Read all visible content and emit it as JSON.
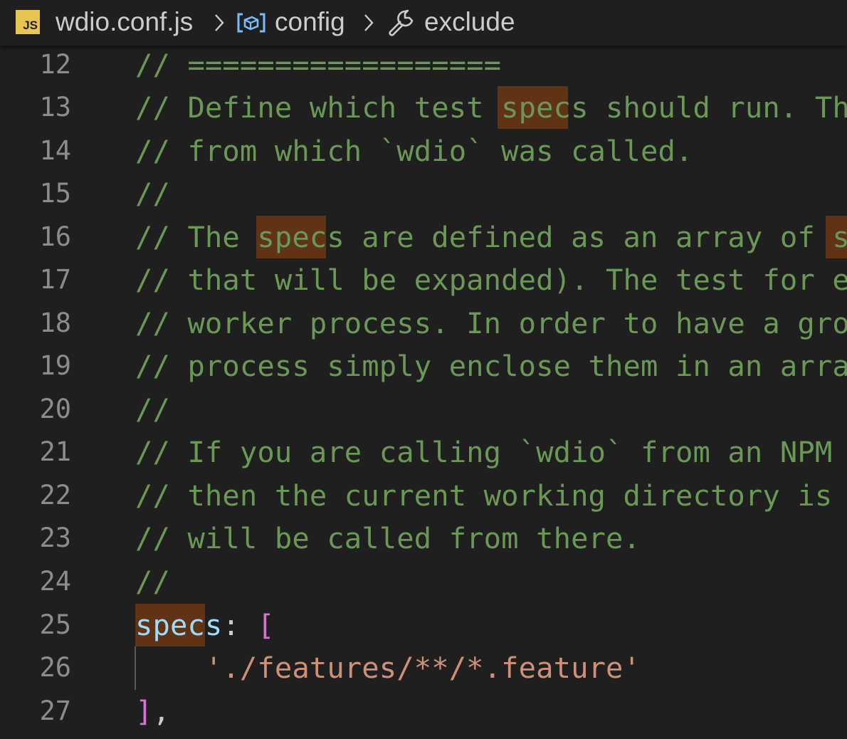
{
  "breadcrumb": {
    "file_badge": "JS",
    "file": "wdio.conf.js",
    "symbol": "config",
    "property": "exclude"
  },
  "editor": {
    "lines": [
      {
        "number": "12",
        "text": "// =================="
      },
      {
        "number": "13",
        "text": "// Define which test specs should run. The"
      },
      {
        "number": "14",
        "text": "// from which `wdio` was called."
      },
      {
        "number": "15",
        "text": "//"
      },
      {
        "number": "16",
        "text": "// The specs are defined as an array of sp"
      },
      {
        "number": "17",
        "text": "// that will be expanded). The test for ea"
      },
      {
        "number": "18",
        "text": "// worker process. In order to have a grou"
      },
      {
        "number": "19",
        "text": "// process simply enclose them in an array"
      },
      {
        "number": "20",
        "text": "//"
      },
      {
        "number": "21",
        "text": "// If you are calling `wdio` from an NPM s"
      },
      {
        "number": "22",
        "text": "// then the current working directory is w"
      },
      {
        "number": "23",
        "text": "// will be called from there."
      },
      {
        "number": "24",
        "text": "//"
      },
      {
        "number": "25",
        "prop": "specs",
        "colon": ": ",
        "bracket": "["
      },
      {
        "number": "26",
        "indent": "    ",
        "string": "'./features/**/*.feature'"
      },
      {
        "number": "27",
        "bracket": "]",
        "punct": ","
      }
    ]
  }
}
